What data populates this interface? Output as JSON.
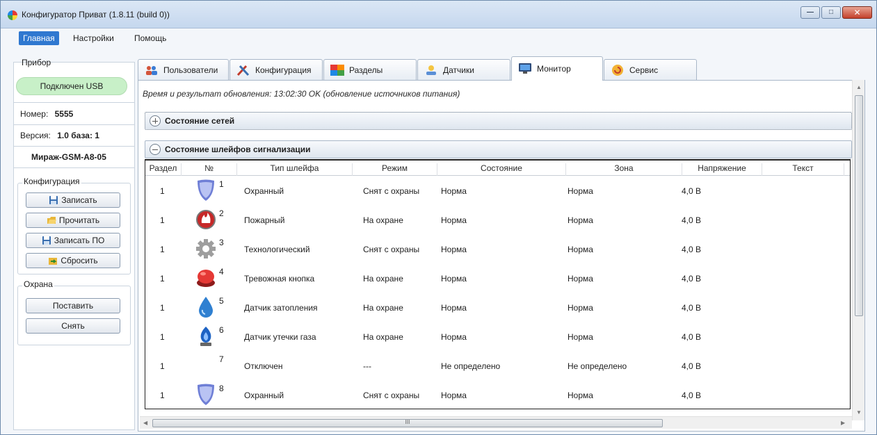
{
  "window": {
    "title": "Конфигуратор Приват (1.8.11 (build 0))"
  },
  "menu": [
    {
      "label": "Главная",
      "active": true
    },
    {
      "label": "Настройки",
      "active": false
    },
    {
      "label": "Помощь",
      "active": false
    }
  ],
  "device": {
    "group_title": "Прибор",
    "connection": "Подключен USB",
    "number_label": "Номер:",
    "number": "5555",
    "version_label": "Версия:",
    "version": "1.0 база: 1",
    "model": "Мираж-GSM-A8-05"
  },
  "config": {
    "group_title": "Конфигурация",
    "buttons": [
      "Записать",
      "Прочитать",
      "Записать ПО",
      "Сбросить"
    ]
  },
  "guard": {
    "group_title": "Охрана",
    "buttons": [
      "Поставить",
      "Снять"
    ]
  },
  "tabs": [
    {
      "label": "Пользователи",
      "icon": "users-icon"
    },
    {
      "label": "Конфигурация",
      "icon": "tools-icon"
    },
    {
      "label": "Разделы",
      "icon": "sections-icon"
    },
    {
      "label": "Датчики",
      "icon": "sensors-icon"
    },
    {
      "label": "Монитор",
      "icon": "monitor-icon",
      "active": true
    },
    {
      "label": "Сервис",
      "icon": "service-icon"
    }
  ],
  "monitor": {
    "update_text": "Время и результат обновления: 13:02:30 OK (обновление источников питания)",
    "networks_title": "Состояние сетей",
    "loops_title": "Состояние шлейфов сигнализации",
    "columns": [
      "Раздел",
      "№",
      "Тип шлейфа",
      "Режим",
      "Состояние",
      "Зона",
      "Напряжение",
      "Текст"
    ],
    "rows": [
      {
        "section": "1",
        "num": "1",
        "icon": "shield-icon",
        "type": "Охранный",
        "mode": "Снят с охраны",
        "state": "Норма",
        "zone": "Норма",
        "voltage": "4,0 В",
        "text": ""
      },
      {
        "section": "1",
        "num": "2",
        "icon": "fire-icon",
        "type": "Пожарный",
        "mode": "На охране",
        "state": "Норма",
        "zone": "Норма",
        "voltage": "4,0 В",
        "text": ""
      },
      {
        "section": "1",
        "num": "3",
        "icon": "gear-icon",
        "type": "Технологический",
        "mode": "Снят с охраны",
        "state": "Норма",
        "zone": "Норма",
        "voltage": "4,0 В",
        "text": ""
      },
      {
        "section": "1",
        "num": "4",
        "icon": "alarm-button-icon",
        "type": "Тревожная кнопка",
        "mode": "На охране",
        "state": "Норма",
        "zone": "Норма",
        "voltage": "4,0 В",
        "text": ""
      },
      {
        "section": "1",
        "num": "5",
        "icon": "water-drop-icon",
        "type": "Датчик затопления",
        "mode": "На охране",
        "state": "Норма",
        "zone": "Норма",
        "voltage": "4,0 В",
        "text": ""
      },
      {
        "section": "1",
        "num": "6",
        "icon": "gas-flame-icon",
        "type": "Датчик утечки газа",
        "mode": "На охране",
        "state": "Норма",
        "zone": "Норма",
        "voltage": "4,0 В",
        "text": ""
      },
      {
        "section": "1",
        "num": "7",
        "icon": "",
        "type": "Отключен",
        "mode": "---",
        "state": "Не определено",
        "zone": "Не определено",
        "voltage": "4,0 В",
        "text": ""
      },
      {
        "section": "1",
        "num": "8",
        "icon": "shield-icon",
        "type": "Охранный",
        "mode": "Снят с охраны",
        "state": "Норма",
        "zone": "Норма",
        "voltage": "4,0 В",
        "text": ""
      }
    ],
    "hscroll_grip": "III"
  }
}
